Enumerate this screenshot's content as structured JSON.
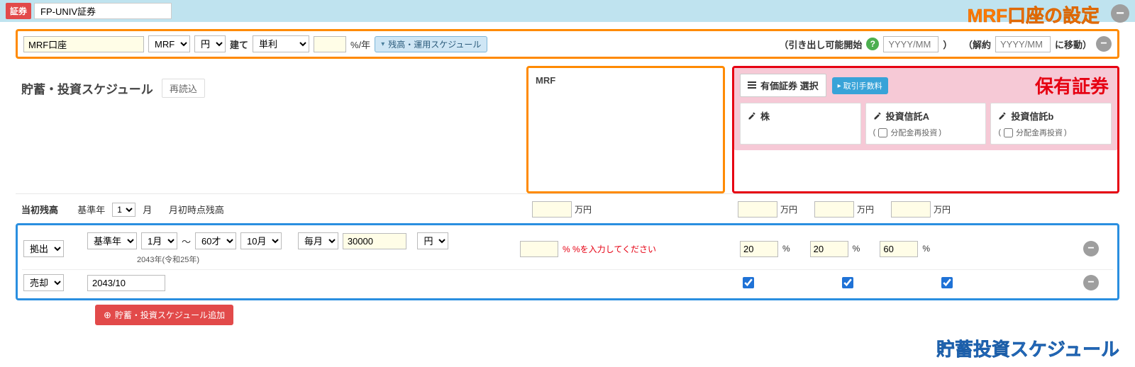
{
  "header": {
    "tag": "証券",
    "company": "FP-UNIV証券",
    "annotation": "MRF口座の設定"
  },
  "account": {
    "name": "MRF口座",
    "type": "MRF",
    "currency": "円",
    "denom_suffix": "建て",
    "interest_mode": "単利",
    "rate_value": "",
    "rate_unit": "%/年",
    "schedule_chip": "残高・運用スケジュール",
    "withdraw_label_pre": "（引き出し可能開始",
    "withdraw_placeholder": "YYYY/MM",
    "withdraw_label_post": "）",
    "cancel_label_pre": "（解約",
    "cancel_placeholder": "YYYY/MM",
    "cancel_label_post": "に移動）"
  },
  "schedule_section": {
    "title": "貯蓄・投資スケジュール",
    "reload": "再読込"
  },
  "mrf_col": {
    "title": "MRF",
    "amount": "",
    "unit": "万円"
  },
  "securities": {
    "select_label": "有価証券 選択",
    "fee_label": "取引手数料",
    "annotation": "保有証券",
    "items": [
      {
        "name": "株",
        "reinvest_label": "",
        "show_reinvest": false
      },
      {
        "name": "投資信託A",
        "reinvest_label": "分配金再投資",
        "show_reinvest": true
      },
      {
        "name": "投資信託b",
        "reinvest_label": "分配金再投資",
        "show_reinvest": true
      }
    ],
    "amount_unit": "万円",
    "amounts": [
      "",
      "",
      ""
    ]
  },
  "balance_row": {
    "label": "当初残高",
    "base_year_label": "基準年",
    "month_sel": "1",
    "month_unit": "月",
    "desc": "月初時点残高"
  },
  "rows": [
    {
      "kind": "拠出",
      "from_year": "基準年",
      "from_month": "1月",
      "tilde": "〜",
      "to_age": "60才",
      "to_month": "10月",
      "freq": "毎月",
      "amount": "30000",
      "unit": "円",
      "sub": "2043年(令和25年)",
      "mrf_pct": "",
      "mrf_warn": "% %を入力してください",
      "sec_pct": [
        "20",
        "20",
        "60"
      ],
      "sec_unit": "%"
    },
    {
      "kind": "売却",
      "date": "2043/10",
      "sec_checked": [
        true,
        true,
        true
      ]
    }
  ],
  "add_button": "貯蓄・投資スケジュール追加",
  "footer_annotation": "貯蓄投資スケジュール"
}
